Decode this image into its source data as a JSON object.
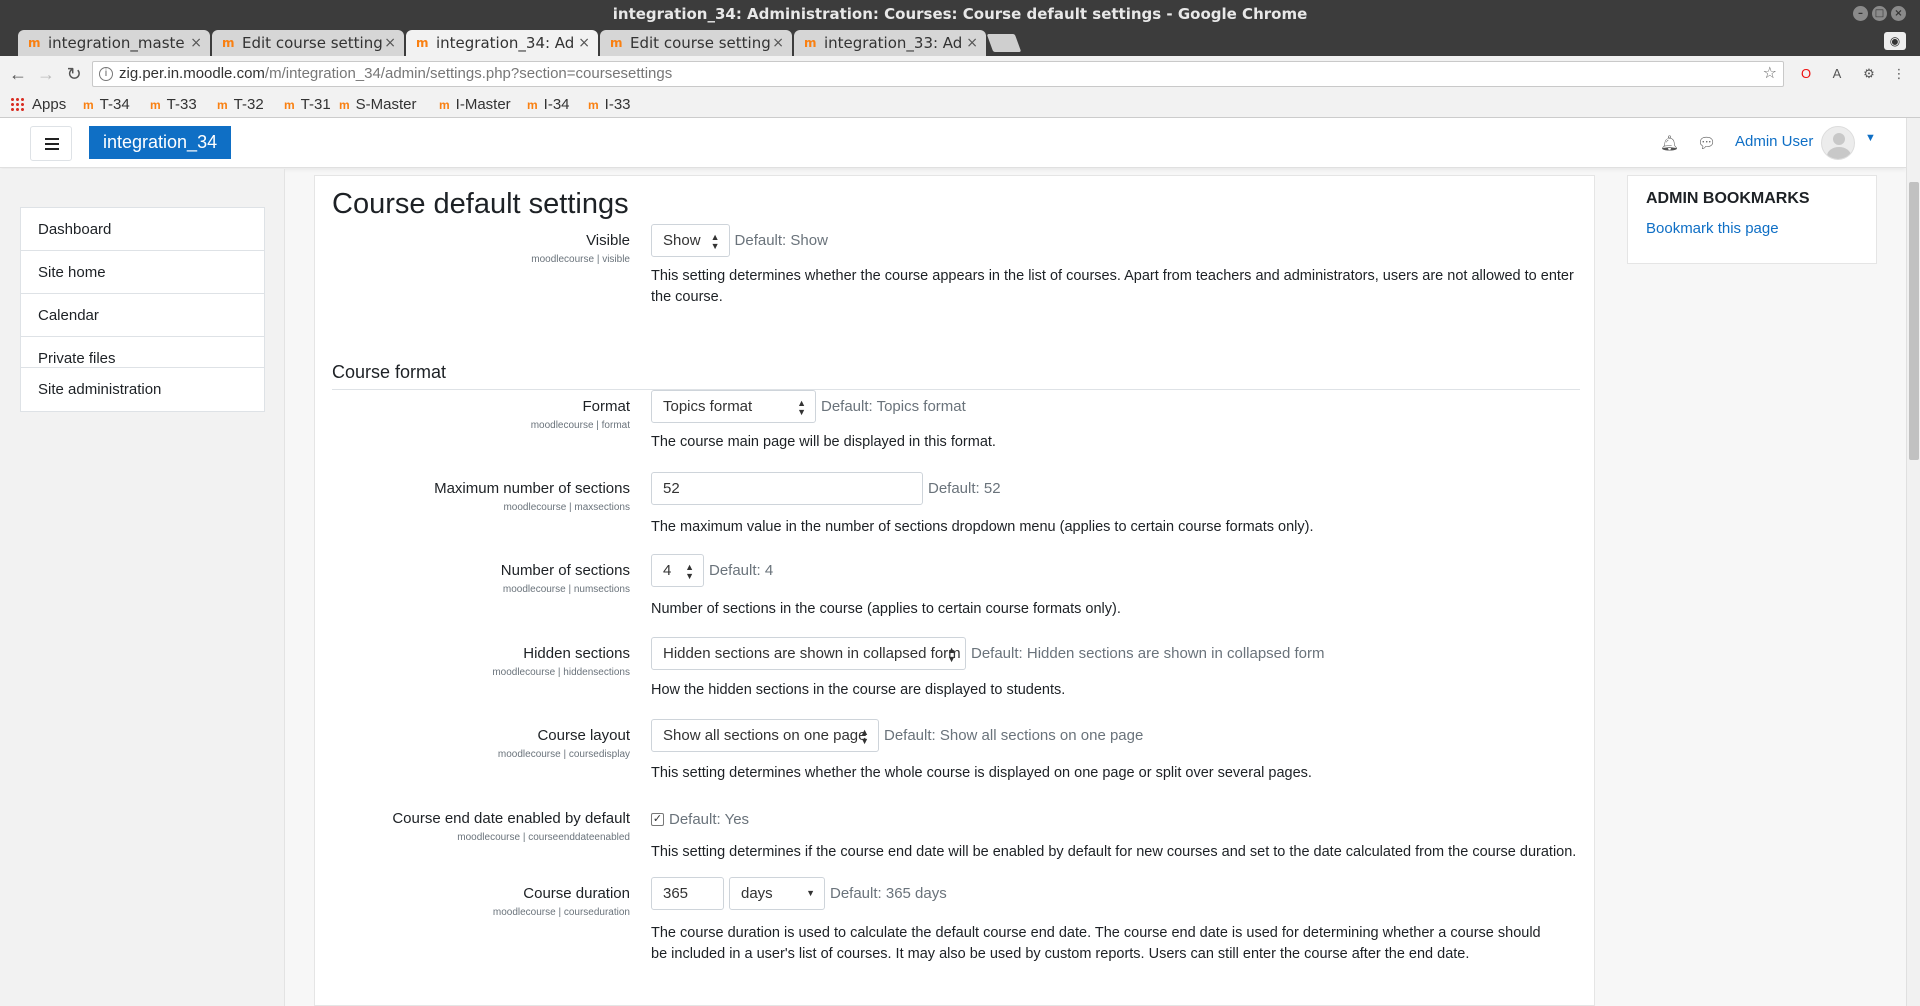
{
  "browser": {
    "window_title": "integration_34: Administration: Courses: Course default settings - Google Chrome",
    "tabs": [
      {
        "title": "integration_maste"
      },
      {
        "title": "Edit course setting"
      },
      {
        "title": "integration_34: Ad"
      },
      {
        "title": "Edit course setting"
      },
      {
        "title": "integration_33: Ad"
      }
    ],
    "url_host": "zig.per.in.moodle.com",
    "url_path": "/m/integration_34/admin/settings.php?section=coursesettings",
    "bookmarks": [
      "Apps",
      "T-34",
      "T-33",
      "T-32",
      "T-31",
      "S-Master",
      "I-Master",
      "I-34",
      "I-33"
    ]
  },
  "navbar": {
    "site_name": "integration_34",
    "username": "Admin User"
  },
  "nav": {
    "primary": [
      "Dashboard",
      "Site home",
      "Calendar",
      "Private files"
    ],
    "admin": "Site administration"
  },
  "main": {
    "title": "Course default settings",
    "section_heading": "Course format",
    "settings": {
      "visible": {
        "label": "Visible",
        "id": "moodlecourse | visible",
        "value": "Show",
        "default": "Default: Show",
        "desc": "This setting determines whether the course appears in the list of courses. Apart from teachers and administrators, users are not allowed to enter the course."
      },
      "format": {
        "label": "Format",
        "id": "moodlecourse | format",
        "value": "Topics format",
        "default": "Default: Topics format",
        "desc": "The course main page will be displayed in this format."
      },
      "maxsections": {
        "label": "Maximum number of sections",
        "id": "moodlecourse | maxsections",
        "value": "52",
        "default": "Default: 52",
        "desc": "The maximum value in the number of sections dropdown menu (applies to certain course formats only)."
      },
      "numsections": {
        "label": "Number of sections",
        "id": "moodlecourse | numsections",
        "value": "4",
        "default": "Default: 4",
        "desc": "Number of sections in the course (applies to certain course formats only)."
      },
      "hiddensections": {
        "label": "Hidden sections",
        "id": "moodlecourse | hiddensections",
        "value": "Hidden sections are shown in collapsed form",
        "default": "Default: Hidden sections are shown in collapsed form",
        "desc": "How the hidden sections in the course are displayed to students."
      },
      "coursedisplay": {
        "label": "Course layout",
        "id": "moodlecourse | coursedisplay",
        "value": "Show all sections on one page",
        "default": "Default: Show all sections on one page",
        "desc": "This setting determines whether the whole course is displayed on one page or split over several pages."
      },
      "courseenddateenabled": {
        "label": "Course end date enabled by default",
        "id": "moodlecourse | courseenddateenabled",
        "checked": true,
        "default": "Default: Yes",
        "desc": "This setting determines if the course end date will be enabled by default for new courses and set to the date calculated from the course duration."
      },
      "courseduration": {
        "label": "Course duration",
        "id": "moodlecourse | courseduration",
        "value": "365",
        "unit": "days",
        "default": "Default: 365 days",
        "desc": "The course duration is used to calculate the default course end date. The course end date is used for determining whether a course should be included in a user's list of courses. It may also be used by custom reports. Users can still enter the course after the end date."
      }
    }
  },
  "admin_bookmarks": {
    "title": "ADMIN BOOKMARKS",
    "link": "Bookmark this page"
  },
  "colors": {
    "brand": "#0f6fc5",
    "moodle_orange": "#f98012"
  }
}
